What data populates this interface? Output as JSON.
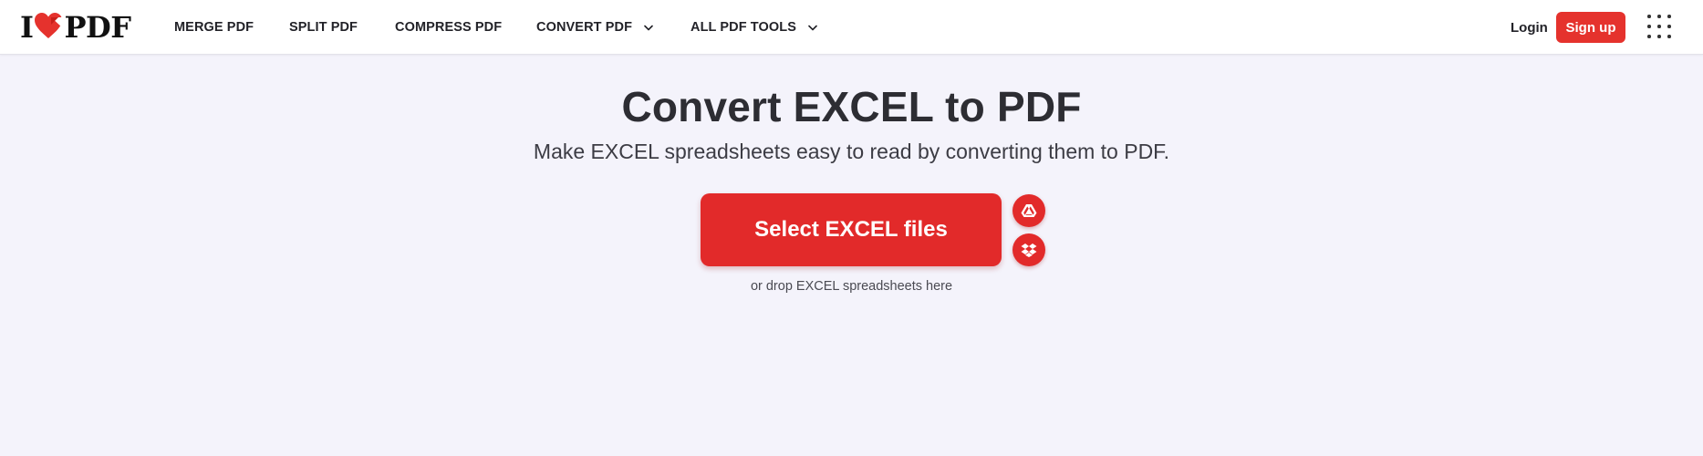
{
  "header": {
    "logo": {
      "left": "I",
      "right": "PDF"
    },
    "nav": [
      {
        "label": "MERGE PDF"
      },
      {
        "label": "SPLIT PDF"
      },
      {
        "label": "COMPRESS PDF"
      },
      {
        "label": "CONVERT PDF"
      },
      {
        "label": "ALL PDF TOOLS"
      }
    ],
    "login_label": "Login",
    "signup_label": "Sign up",
    "icons": {
      "apps": "grid-icon",
      "convert_dropdown": "chevron-down-icon",
      "all_tools_dropdown": "chevron-down-icon"
    }
  },
  "main": {
    "title": "Convert EXCEL to PDF",
    "subtitle": "Make EXCEL spreadsheets easy to read by converting them to PDF.",
    "select_button_label": "Select EXCEL files",
    "drop_hint": "or drop EXCEL spreadsheets here",
    "cloud_icons": [
      "google-drive-icon",
      "dropbox-icon"
    ]
  },
  "colors": {
    "brand_red": "#e5322d",
    "button_red": "#e22a2a",
    "background": "#f4f3fb",
    "header_bg": "#ffffff",
    "text_dark": "#2d2d33"
  }
}
